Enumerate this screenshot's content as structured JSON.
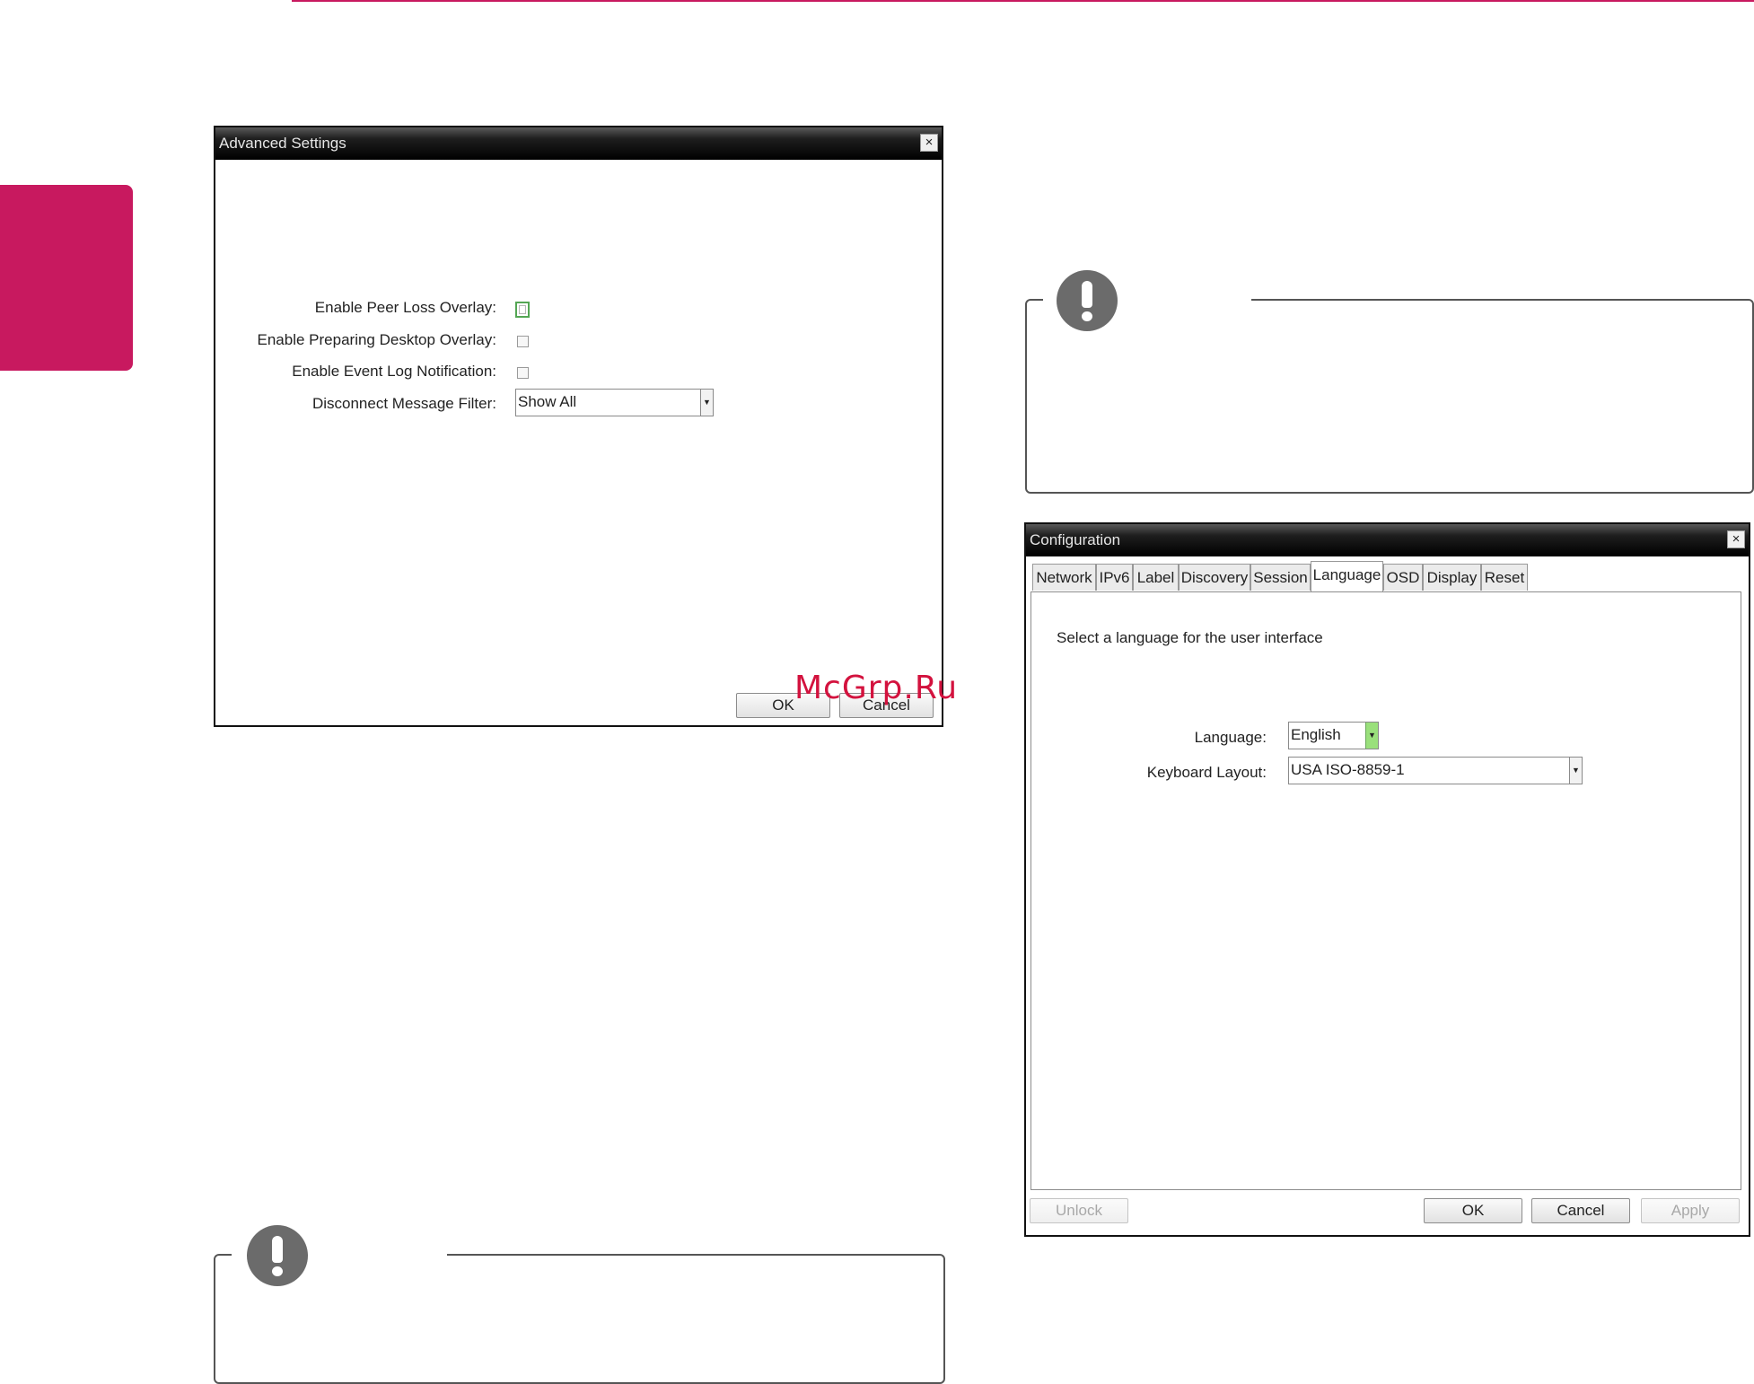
{
  "advanced_settings": {
    "title": "Advanced Settings",
    "close_glyph": "×",
    "fields": [
      {
        "label": "Enable Peer Loss Overlay:"
      },
      {
        "label": "Enable Preparing Desktop Overlay:"
      },
      {
        "label": "Enable Event Log Notification:"
      },
      {
        "label": "Disconnect Message Filter:"
      }
    ],
    "filter_value": "Show All",
    "ok_label": "OK",
    "cancel_label": "Cancel"
  },
  "configuration": {
    "title": "Configuration",
    "close_glyph": "×",
    "tabs": [
      "Network",
      "IPv6",
      "Label",
      "Discovery",
      "Session",
      "Language",
      "OSD",
      "Display",
      "Reset"
    ],
    "active_tab": "Language",
    "description": "Select a language for the user interface",
    "language_label": "Language:",
    "language_value": "English",
    "keyboard_label": "Keyboard Layout:",
    "keyboard_value": "USA ISO-8859-1",
    "buttons": {
      "unlock": "Unlock",
      "ok": "OK",
      "cancel": "Cancel",
      "apply": "Apply"
    }
  },
  "watermark": "McGrp.Ru",
  "icons": {
    "note": "exclamation-note-icon",
    "dropdown": "chevron-down-icon",
    "close": "close-icon"
  },
  "colors": {
    "accent": "#c8195f",
    "watermark": "#d3123e",
    "focus": "#54a654"
  }
}
